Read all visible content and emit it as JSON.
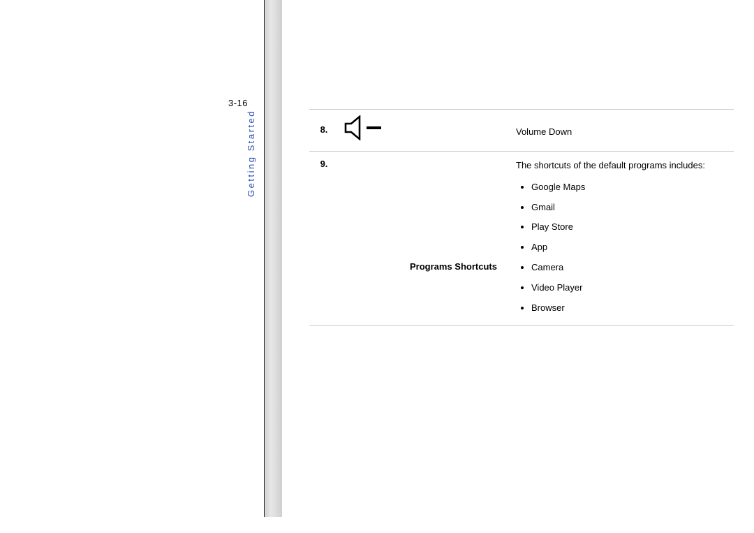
{
  "page_number": "3-16",
  "section_title": "Getting Started",
  "rows": {
    "r8": {
      "num": "8.",
      "desc": "Volume Down"
    },
    "r9": {
      "num": "9.",
      "label": "Programs Shortcuts",
      "intro": "The shortcuts of the default programs includes:",
      "items": {
        "i0": "Google Maps",
        "i1": "Gmail",
        "i2": "Play Store",
        "i3": "App",
        "i4": "Camera",
        "i5": "Video Player",
        "i6": "Browser"
      }
    }
  }
}
